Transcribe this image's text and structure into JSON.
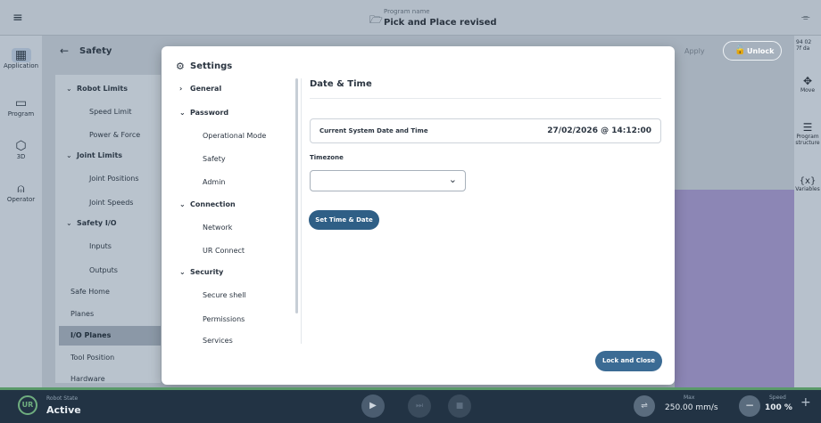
{
  "header": {
    "program_name_label": "Program name",
    "program_name": "Pick and Place revised",
    "right_snippet": "94 02\n7f da"
  },
  "leftnav": {
    "items": [
      {
        "label": "Application",
        "icon": "grid-icon"
      },
      {
        "label": "Program",
        "icon": "square-icon"
      },
      {
        "label": "3D",
        "icon": "cube-icon"
      },
      {
        "label": "Operator",
        "icon": "person-icon"
      }
    ]
  },
  "rightnav": {
    "items": [
      {
        "label": "Move",
        "icon": "move-icon"
      },
      {
        "label": "Program structure",
        "icon": "list-icon"
      },
      {
        "label": "Variables",
        "icon": "variables-icon"
      }
    ]
  },
  "page": {
    "title": "Safety",
    "apply": "Apply",
    "unlock": "Unlock"
  },
  "tree": {
    "items": [
      "Robot Limits",
      "Speed Limit",
      "Power & Force",
      "Joint Limits",
      "Joint Positions",
      "Joint Speeds",
      "Safety I/O",
      "Inputs",
      "Outputs",
      "Safe Home",
      "Planes",
      "I/O Planes",
      "Tool Position",
      "Hardware"
    ]
  },
  "settings": {
    "title": "Settings",
    "menu": {
      "general": "General",
      "password": "Password",
      "operational_mode": "Operational Mode",
      "safety": "Safety",
      "admin": "Admin",
      "connection": "Connection",
      "network": "Network",
      "ur_connect": "UR Connect",
      "security": "Security",
      "secure_shell": "Secure shell",
      "permissions": "Permissions",
      "services": "Services"
    },
    "content": {
      "title": "Date & Time",
      "current_label": "Current System Date and Time",
      "current_value": "27/02/2026 @ 14:12:00",
      "timezone_label": "Timezone",
      "timezone_value": "",
      "set_button": "Set Time & Date",
      "lock_close": "Lock and Close"
    }
  },
  "status": {
    "robot_state_label": "Robot State",
    "robot_state": "Active",
    "max_label": "Max",
    "max_value": "250.00 mm/s",
    "speed_label": "Speed",
    "speed_value": "100 %"
  }
}
